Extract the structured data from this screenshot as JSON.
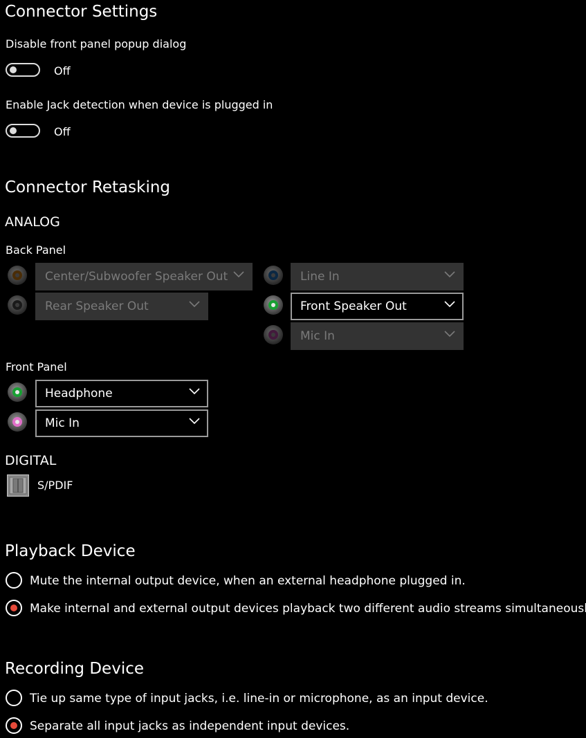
{
  "connector_settings": {
    "title": "Connector Settings",
    "disable_popup": {
      "label": "Disable front panel popup dialog",
      "state": "Off"
    },
    "jack_detection": {
      "label": "Enable Jack detection when device is plugged in",
      "state": "Off"
    }
  },
  "retasking": {
    "title": "Connector Retasking",
    "analog_label": "ANALOG",
    "back_panel": {
      "label": "Back Panel",
      "jacks": [
        {
          "value": "Center/Subwoofer Speaker Out",
          "color": "#b06a10",
          "enabled": false
        },
        {
          "value": "Rear Speaker Out",
          "color": "#404040",
          "enabled": false
        },
        {
          "value": "Line In",
          "color": "#1c5fa0",
          "enabled": false
        },
        {
          "value": "Front Speaker Out",
          "color": "#18a033",
          "enabled": true
        },
        {
          "value": "Mic In",
          "color": "#a04090",
          "enabled": false
        }
      ]
    },
    "front_panel": {
      "label": "Front Panel",
      "jacks": [
        {
          "value": "Headphone",
          "color": "#18a033",
          "enabled": true
        },
        {
          "value": "Mic In",
          "color": "#e070c8",
          "enabled": true
        }
      ]
    },
    "digital_label": "DIGITAL",
    "spdif_label": "S/PDIF"
  },
  "playback": {
    "title": "Playback Device",
    "options": [
      {
        "label": "Mute the internal output device, when an external headphone plugged in.",
        "selected": false
      },
      {
        "label": "Make internal and external output devices playback two different audio streams simultaneously.",
        "selected": true
      }
    ]
  },
  "recording": {
    "title": "Recording Device",
    "options": [
      {
        "label": "Tie up same type of input jacks, i.e. line-in or microphone, as an input device.",
        "selected": false
      },
      {
        "label": "Separate all input jacks as independent input devices.",
        "selected": true
      }
    ]
  },
  "colors": {
    "accent_radio": "#e64a3a",
    "disabled_bg": "#333333",
    "disabled_text": "#7a7a7a"
  }
}
